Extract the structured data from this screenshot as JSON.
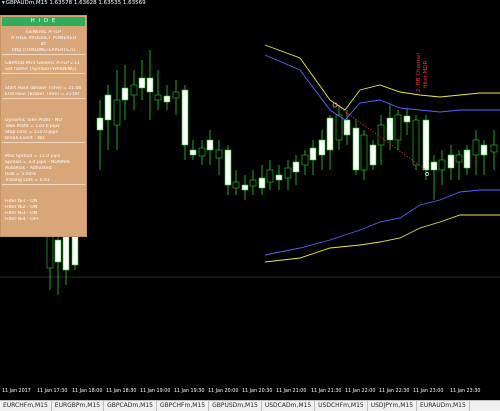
{
  "symbol_bar": {
    "text": "GBPAUDm,M15  1.63578 1.63628 1.63535 1.63569"
  },
  "panel": {
    "hide_label": "H I D E",
    "promo": [
      "GENERIC A-TLP",
      "A FREE PRODUCT POWERED",
      "BY",
      "http://TRADING-EXPERTS.ru"
    ],
    "info": [
      "GBPAUD M15 Generic A-TLP v.11",
      "Set name: [Symbol]-WARNING]"
    ],
    "hours": [
      "Start Hour (Broker Time) = 21:00",
      "End Hour (Broker Time) = 23:00"
    ],
    "targets": [
      "Dynamic Take Profit - NO",
      "Take Profit = 110.0 pips",
      "Stop Loss = 110.0 pips",
      "Break Event - NO"
    ],
    "spread": [
      "Max Spread = 11.0 pips",
      "Spread = 3.4 pips - NORMAL",
      "AutoRisk - Activated",
      "Risk = 5.00%",
      "Trading Lots = 0.81"
    ],
    "filters": [
      "Filter №1 - ON",
      "Filter №2 - ON",
      "Filter №3 - ON",
      "Filter №4 - OFF"
    ]
  },
  "channel_label": [
    "2. BB Channel",
    "filter MDR"
  ],
  "time_axis": [
    "11 Jan 2017",
    "11 Jan 17:30",
    "11 Jan 18:00",
    "11 Jan 18:30",
    "11 Jan 19:00",
    "11 Jan 19:30",
    "11 Jan 20:00",
    "11 Jan 20:30",
    "11 Jan 21:00",
    "11 Jan 21:30",
    "11 Jan 22:00",
    "11 Jan 22:30",
    "11 Jan 23:00",
    "11 Jan 23:30"
  ],
  "tabs": [
    "EURCHFm,M15",
    "EURGBPm,M15",
    "GBPCADm,M15",
    "GBPCHFm,M15",
    "GBPUSDm,M15",
    "USDCADm,M15",
    "USDCHFm,M15",
    "USDJPYm,M15",
    "EURAUDm,M15"
  ],
  "colors": {
    "bull": "#ffffff",
    "bear": "#000000",
    "wick": "#2bd02b",
    "outer_band": "#e8e84a",
    "inner_band": "#5a5aff",
    "signal": "#ff3030",
    "ma": "#7a7aff"
  }
}
